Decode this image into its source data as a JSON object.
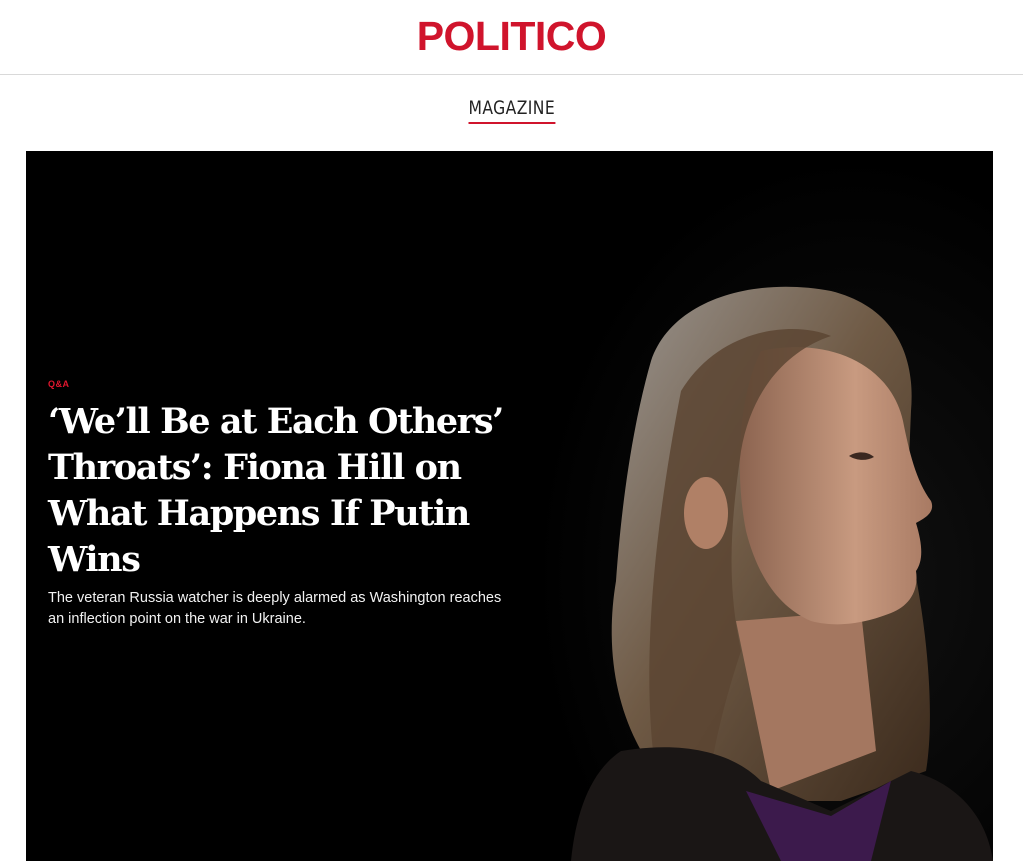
{
  "header": {
    "logo": "POLITICO",
    "section": "MAGAZINE"
  },
  "article": {
    "kicker": "Q&A",
    "headline": "‘We’ll Be at Each Others’ Throats’: Fiona Hill on What Happens If Putin Wins",
    "dek": "The veteran Russia watcher is deeply alarmed as Washington reaches an inflection point on the war in Ukraine."
  },
  "colors": {
    "brand": "#d0142c",
    "hero_bg": "#000000",
    "text_on_dark": "#ffffff"
  }
}
